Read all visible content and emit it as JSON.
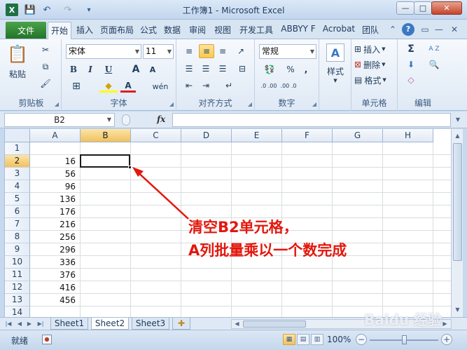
{
  "window": {
    "title": "工作簿1 - Microsoft Excel",
    "minimize": "—",
    "maximize": "□",
    "close": "✕"
  },
  "quick_access": {
    "excel": "X",
    "save": "💾",
    "undo": "↶",
    "redo": "↷",
    "more": "▾"
  },
  "ribbon_tabs": {
    "file": "文件",
    "tabs": [
      "开始",
      "插入",
      "页面布局",
      "公式",
      "数据",
      "审阅",
      "视图",
      "开发工具",
      "ABBYY F",
      "Acrobat",
      "团队"
    ]
  },
  "ribbon": {
    "clipboard": {
      "label": "剪贴板",
      "paste": "粘贴",
      "cut": "✂",
      "copy": "⧉",
      "painter": "🖌"
    },
    "font": {
      "label": "字体",
      "font_name": "宋体",
      "font_size": "11",
      "bold": "B",
      "italic": "I",
      "underline": "U",
      "grow": "A",
      "shrink": "A",
      "border": "⊞",
      "fill": "◆",
      "color": "A",
      "phonetic": "wén"
    },
    "alignment": {
      "label": "对齐方式"
    },
    "number": {
      "label": "数字",
      "format": "常规",
      "percent": "%",
      "comma": ",",
      "inc_dec": ".0 .00",
      "dec_dec": ".00 .0"
    },
    "styles": {
      "label": "样式",
      "icon": "A"
    },
    "cells": {
      "label": "单元格",
      "insert": "插入",
      "delete": "删除",
      "format": "格式"
    },
    "editing": {
      "label": "编辑",
      "sum": "Σ",
      "sort": "A Z",
      "fill": "⬇",
      "find": "🔍",
      "clear": "◇"
    }
  },
  "formula_bar": {
    "name_box": "B2",
    "fx": "fx",
    "value": ""
  },
  "sheet": {
    "columns": [
      "A",
      "B",
      "C",
      "D",
      "E",
      "F",
      "G",
      "H"
    ],
    "rows": [
      "1",
      "2",
      "3",
      "4",
      "5",
      "6",
      "7",
      "8",
      "9",
      "10",
      "11",
      "12",
      "13",
      "14"
    ],
    "col_a_values": [
      "",
      "16",
      "56",
      "96",
      "136",
      "176",
      "216",
      "256",
      "296",
      "336",
      "376",
      "416",
      "456",
      ""
    ],
    "selected_col": "B",
    "selected_row": "2",
    "annotation": [
      "清空B2单元格，",
      "A列批量乘以一个数完成"
    ]
  },
  "sheet_tabs": [
    "Sheet1",
    "Sheet2",
    "Sheet3"
  ],
  "active_sheet": "Sheet2",
  "status": {
    "ready": "就绪",
    "zoom": "100%",
    "minus": "−",
    "plus": "+"
  },
  "watermark": "Baidu 经验"
}
